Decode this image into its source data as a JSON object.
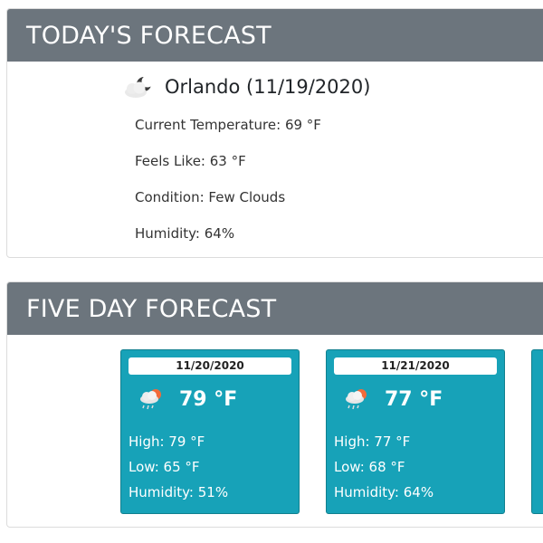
{
  "today": {
    "header": "TODAY'S FORECAST",
    "icon": "few-clouds-night-icon",
    "city_line": "Orlando (11/19/2020)",
    "current_temperature": "Current Temperature: 69 °F",
    "feels_like": "Feels Like: 63 °F",
    "condition": "Condition: Few Clouds",
    "humidity": "Humidity: 64%"
  },
  "five_day": {
    "header": "FIVE DAY FORECAST",
    "days": [
      {
        "date": "11/20/2020",
        "icon": "rain-sun-icon",
        "temp": "79 °F",
        "high": "High: 79 °F",
        "low": "Low: 65 °F",
        "humidity": "Humidity: 51%"
      },
      {
        "date": "11/21/2020",
        "icon": "rain-sun-icon",
        "temp": "77 °F",
        "high": "High: 77 °F",
        "low": "Low: 68 °F",
        "humidity": "Humidity: 64%"
      }
    ]
  },
  "colors": {
    "header_bg": "#6c757d",
    "day_card_bg": "#17a2b8"
  }
}
